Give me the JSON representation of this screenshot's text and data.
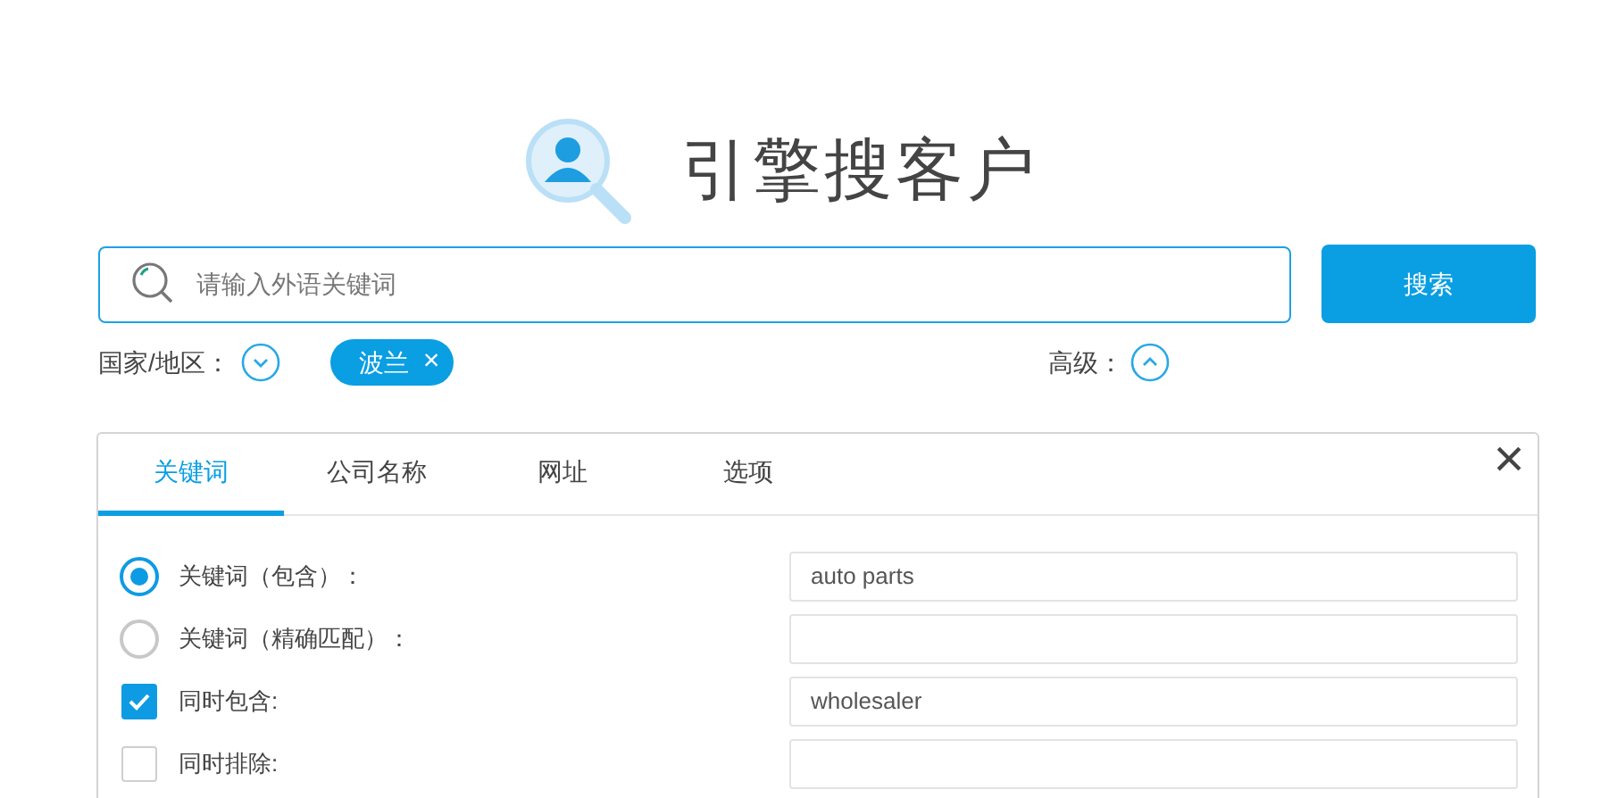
{
  "title": "引擎搜客户",
  "search": {
    "placeholder": "请输入外语关键词",
    "button": "搜索"
  },
  "country": {
    "label": "国家/地区：",
    "expanded": false,
    "tags": [
      {
        "label": "波兰",
        "remove": "×"
      }
    ]
  },
  "advanced": {
    "label": "高级：",
    "expanded": true
  },
  "panel": {
    "close": "×",
    "tabs": [
      {
        "label": "关键词",
        "selected": true
      },
      {
        "label": "公司名称",
        "selected": false
      },
      {
        "label": "网址",
        "selected": false
      },
      {
        "label": "选项",
        "selected": false
      }
    ],
    "rows": [
      {
        "kind": "radio",
        "label": "关键词（包含）：",
        "checked": true,
        "value": "auto parts"
      },
      {
        "kind": "radio",
        "label": "关键词（精确匹配）：",
        "checked": false,
        "value": ""
      },
      {
        "kind": "checkbox",
        "label": "同时包含:",
        "checked": true,
        "value": "wholesaler"
      },
      {
        "kind": "checkbox",
        "label": "同时排除:",
        "checked": false,
        "value": ""
      }
    ]
  }
}
